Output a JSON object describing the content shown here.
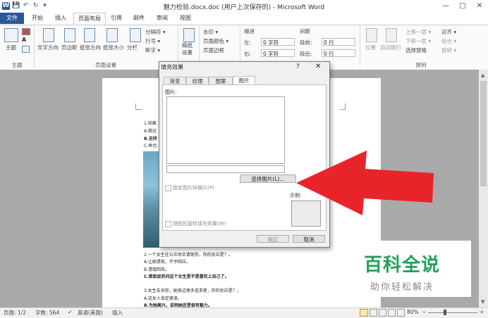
{
  "window": {
    "title": "魅力检验.docx.doc (用户上次保存的)  -  Microsoft Word",
    "help": "?",
    "minimize": "—",
    "maximize": "□",
    "close": "✕"
  },
  "qat": [
    "W",
    "💾",
    "↶",
    "↻",
    "▾"
  ],
  "tabs": [
    "文件",
    "开始",
    "插入",
    "页面布局",
    "引用",
    "邮件",
    "审阅",
    "视图"
  ],
  "ribbon": {
    "theme": {
      "themes": "主题",
      "group": "主题"
    },
    "page_setup": {
      "text_dir": "文字方向",
      "margins": "页边距",
      "orientation": "纸张方向",
      "size": "纸张大小",
      "columns": "分栏",
      "breaks": "分隔符 ▾",
      "line_numbers": "行号 ▾",
      "hyphenation": "断字 ▾",
      "group": "页面设置"
    },
    "draft": {
      "label": "稿纸\n设置"
    },
    "background": {
      "watermark": "水印 ▾",
      "page_color": "页面颜色 ▾",
      "page_border": "页面边框"
    },
    "paragraph": {
      "indent": "缩进",
      "spacing": "间距",
      "left_label": "左:",
      "left_value": "0 字符",
      "right_label": "右:",
      "right_value": "0 字符",
      "before_label": "段前:",
      "before_value": "0 行",
      "after_label": "段后:",
      "after_value": "0 行"
    },
    "arrange": {
      "position": "位置",
      "wrap": "自动换行",
      "bring_forward": "上移一层 ▾",
      "send_backward": "下移一层 ▾",
      "selection_pane": "选择窗格",
      "align": "对齐 ▾",
      "group_btn": "组合 ▾",
      "rotate": "旋转 ▾",
      "group": "排列"
    }
  },
  "document": {
    "lines": [
      {
        "text": "1.如果",
        "bold": false
      },
      {
        "text": "A.疏远",
        "bold": false
      },
      {
        "text": "B.无所",
        "bold": true
      },
      {
        "text": "C.再也",
        "bold": false
      },
      {
        "text": "2.一个女生在公众场合请现你，你的反应是？。",
        "bold": false
      },
      {
        "text": "A.让她请现，不予回应。",
        "bold": false
      },
      {
        "text": "B.请现回去。",
        "bold": false
      },
      {
        "text": "C.厚脸皮的问这个女生是不是喜欢上自己了。",
        "bold": true
      },
      {
        "text": "3.女生告诉你，她身边很多追求者，你的反应是？。",
        "bold": false
      },
      {
        "text": "A.这女人肯定很浪。",
        "bold": false
      },
      {
        "text": "B.为她高兴，说明她还是很有魅力。",
        "bold": true
      }
    ]
  },
  "dialog": {
    "title": "填充效果",
    "help": "?",
    "close": "✕",
    "tabs": [
      "渐变",
      "纹理",
      "图案",
      "图片"
    ],
    "picture_label": "图片:",
    "select_button": "选择图片(L)...",
    "lock_ratio": "锁定图片纵横比(P)",
    "rotate_with_shape": "随图形旋转填充效果(W)",
    "sample_label": "示例:",
    "ok": "确定",
    "cancel": "取消"
  },
  "status": {
    "page": "页面: 1/2",
    "words": "字数: 564",
    "lang": "英语(美国)",
    "insert": "插入",
    "zoom": "80%",
    "zoom_minus": "−",
    "zoom_plus": "+"
  },
  "watermark": {
    "title": "百科全说",
    "subtitle": "助你轻松解决"
  },
  "colors": {
    "accent": "#2b579a",
    "arrow": "#e8242a",
    "watermark_green": "#22a05a"
  }
}
